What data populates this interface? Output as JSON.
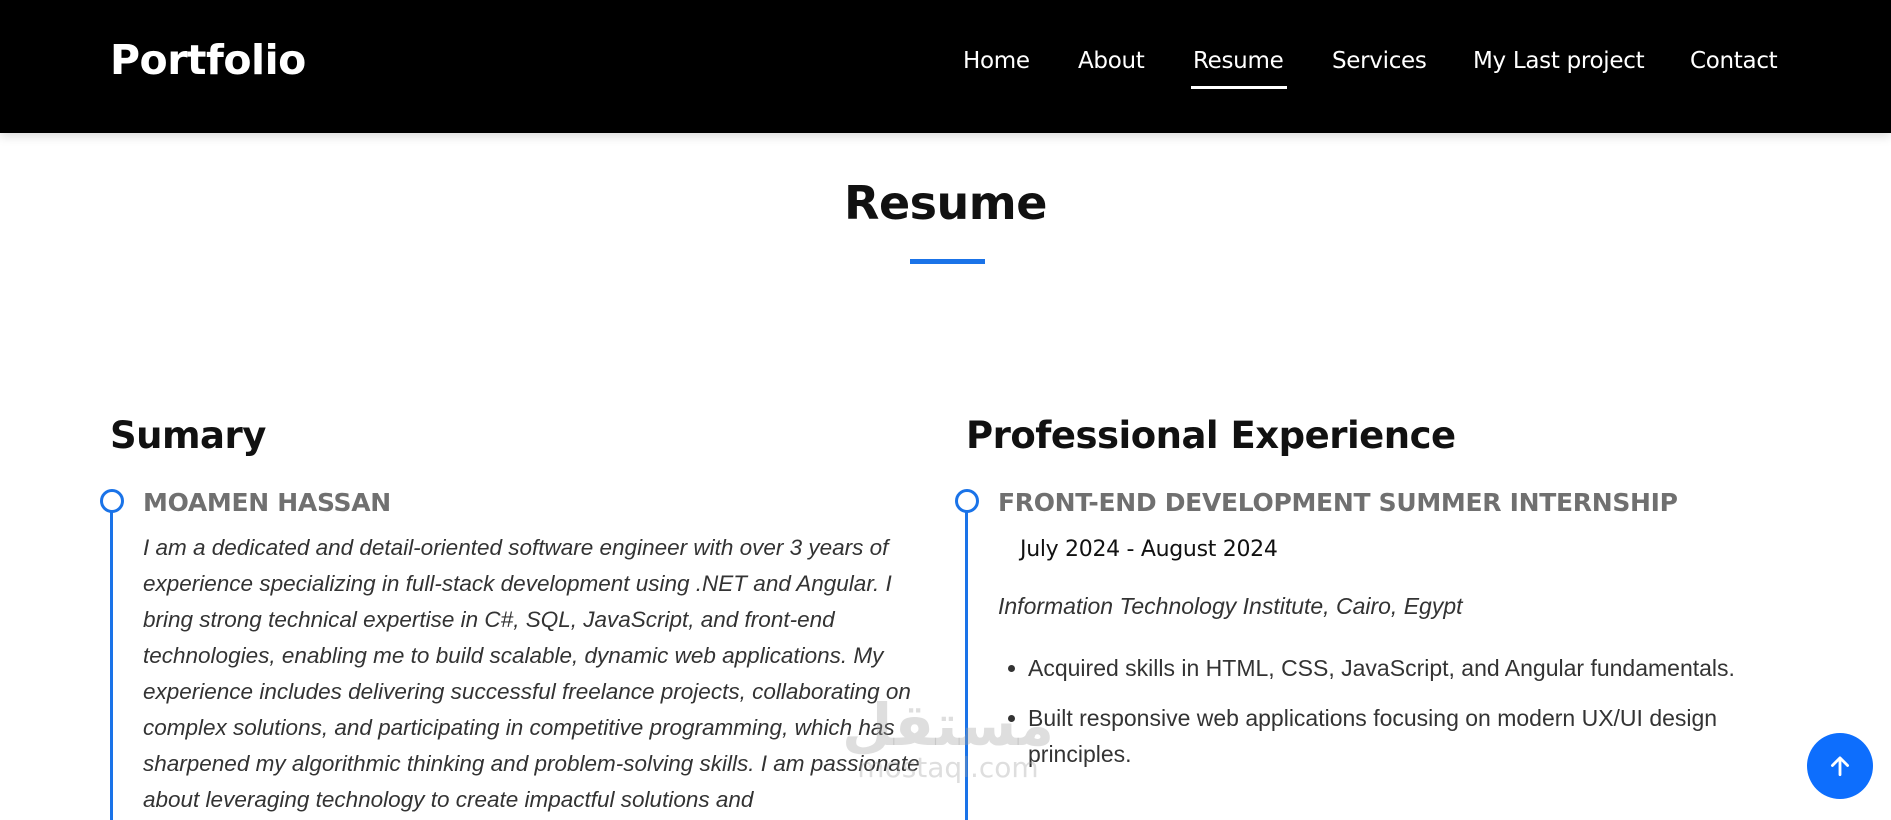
{
  "header": {
    "logo": "Portfolio",
    "nav": [
      {
        "label": "Home",
        "active": false
      },
      {
        "label": "About",
        "active": false
      },
      {
        "label": "Resume",
        "active": true
      },
      {
        "label": "Services",
        "active": false
      },
      {
        "label": "My Last project",
        "active": false
      },
      {
        "label": "Contact",
        "active": false
      }
    ]
  },
  "section": {
    "title": "Resume"
  },
  "summary": {
    "heading": "Sumary",
    "name": "MOAMEN HASSAN",
    "text": "I am a dedicated and detail-oriented software engineer with over 3 years of experience specializing in full-stack development using .NET and Angular. I bring strong technical expertise in C#, SQL, JavaScript, and front-end technologies, enabling me to build scalable, dynamic web applications. My experience includes delivering successful freelance projects, collaborating on complex solutions, and participating in competitive programming, which has sharpened my algorithmic thinking and problem-solving skills. I am passionate about leveraging technology to create impactful solutions and"
  },
  "experience": {
    "heading": "Professional Experience",
    "items": [
      {
        "title": "FRONT-END DEVELOPMENT SUMMER INTERNSHIP",
        "date": "July 2024 - August 2024",
        "org": "Information Technology Institute, Cairo, Egypt",
        "bullets": [
          "Acquired skills in HTML, CSS, JavaScript, and Angular fundamentals.",
          "Built responsive web applications focusing on modern UX/UI design principles."
        ]
      }
    ]
  },
  "watermark": {
    "arabic": "مستقل",
    "latin": "mostaql.com"
  },
  "icons": {
    "back_to_top": "arrow-up-icon"
  },
  "colors": {
    "accent": "#1a73e8",
    "navbar": "#000000",
    "button": "#0d6efd"
  }
}
